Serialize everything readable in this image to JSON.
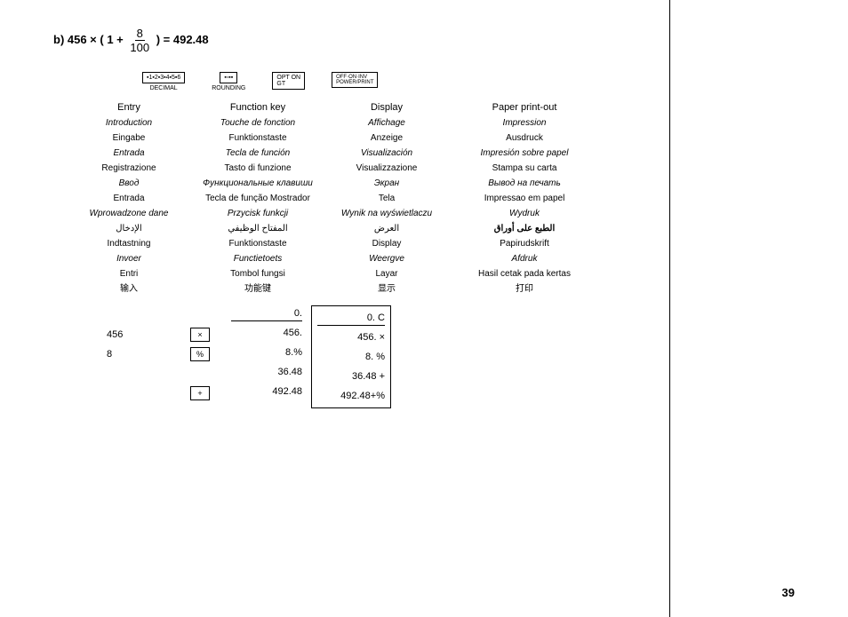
{
  "page": {
    "number": "39"
  },
  "formula": {
    "prefix": "b) 456 × ( 1 +",
    "numerator": "8",
    "denominator": "100",
    "suffix": ") = 492.48"
  },
  "icons": [
    {
      "id": "decimal",
      "visual": "▪▪▪▪▪▪",
      "label": "DECIMAL"
    },
    {
      "id": "rounding",
      "visual": "▪▫▪▪",
      "label": "ROUNDING"
    },
    {
      "id": "opt-gt",
      "visual": "OPT ON GT",
      "label": ""
    },
    {
      "id": "power",
      "visual": "OFF·ON·INV POWER/PRINT",
      "label": ""
    }
  ],
  "column_headers": {
    "entry": "Entry",
    "function_key": "Function key",
    "display": "Display",
    "paper_print": "Paper print-out"
  },
  "labels": [
    [
      "Entry",
      "Function key",
      "Display",
      "Paper print-out"
    ],
    [
      "Introduction",
      "Touche de fonction",
      "Affichage",
      "Impression"
    ],
    [
      "Eingabe",
      "Funktionstaste",
      "Anzeige",
      "Ausdruck"
    ],
    [
      "Entrada",
      "Tecla de función",
      "Visualización",
      "Impresión sobre papel"
    ],
    [
      "Registrazione",
      "Tasto di funzione",
      "Visualizzazione",
      "Stampa su carta"
    ],
    [
      "Ввод",
      "Функциональные клавиши",
      "Экран",
      "Вывод на печать"
    ],
    [
      "Entrada",
      "Tecla de função Mostrador",
      "Tela",
      "Impressao em papel"
    ],
    [
      "Wprowadzone dane",
      "Przycisk funkcji",
      "Wynik na wyświetlaczu",
      "Wydruk"
    ],
    [
      "الإدخال",
      "المفتاح الوظيفي",
      "العرض",
      "الطبع على أوراق"
    ],
    [
      "Indtastning",
      "Funktionstaste",
      "Display",
      "Papirudskrift"
    ],
    [
      "Invoer",
      "Functietoets",
      "Weergve",
      "Afdruk"
    ],
    [
      "Entri",
      "Tombol fungsi",
      "Layar",
      "Hasil cetak pada kertas"
    ],
    [
      "输入",
      "功能键",
      "显示",
      "打印"
    ]
  ],
  "steps": {
    "entries": [
      "456",
      "8",
      "",
      ""
    ],
    "keys": [
      "×",
      "%",
      "",
      "+"
    ],
    "display_values": [
      "0.",
      "456.",
      "8.%",
      "36.48",
      "492.48"
    ],
    "display_header": "0. C",
    "print_values": [
      "456. ×",
      "8. %",
      "36.48 +",
      "492.48+%"
    ],
    "print_header": "0. C"
  }
}
